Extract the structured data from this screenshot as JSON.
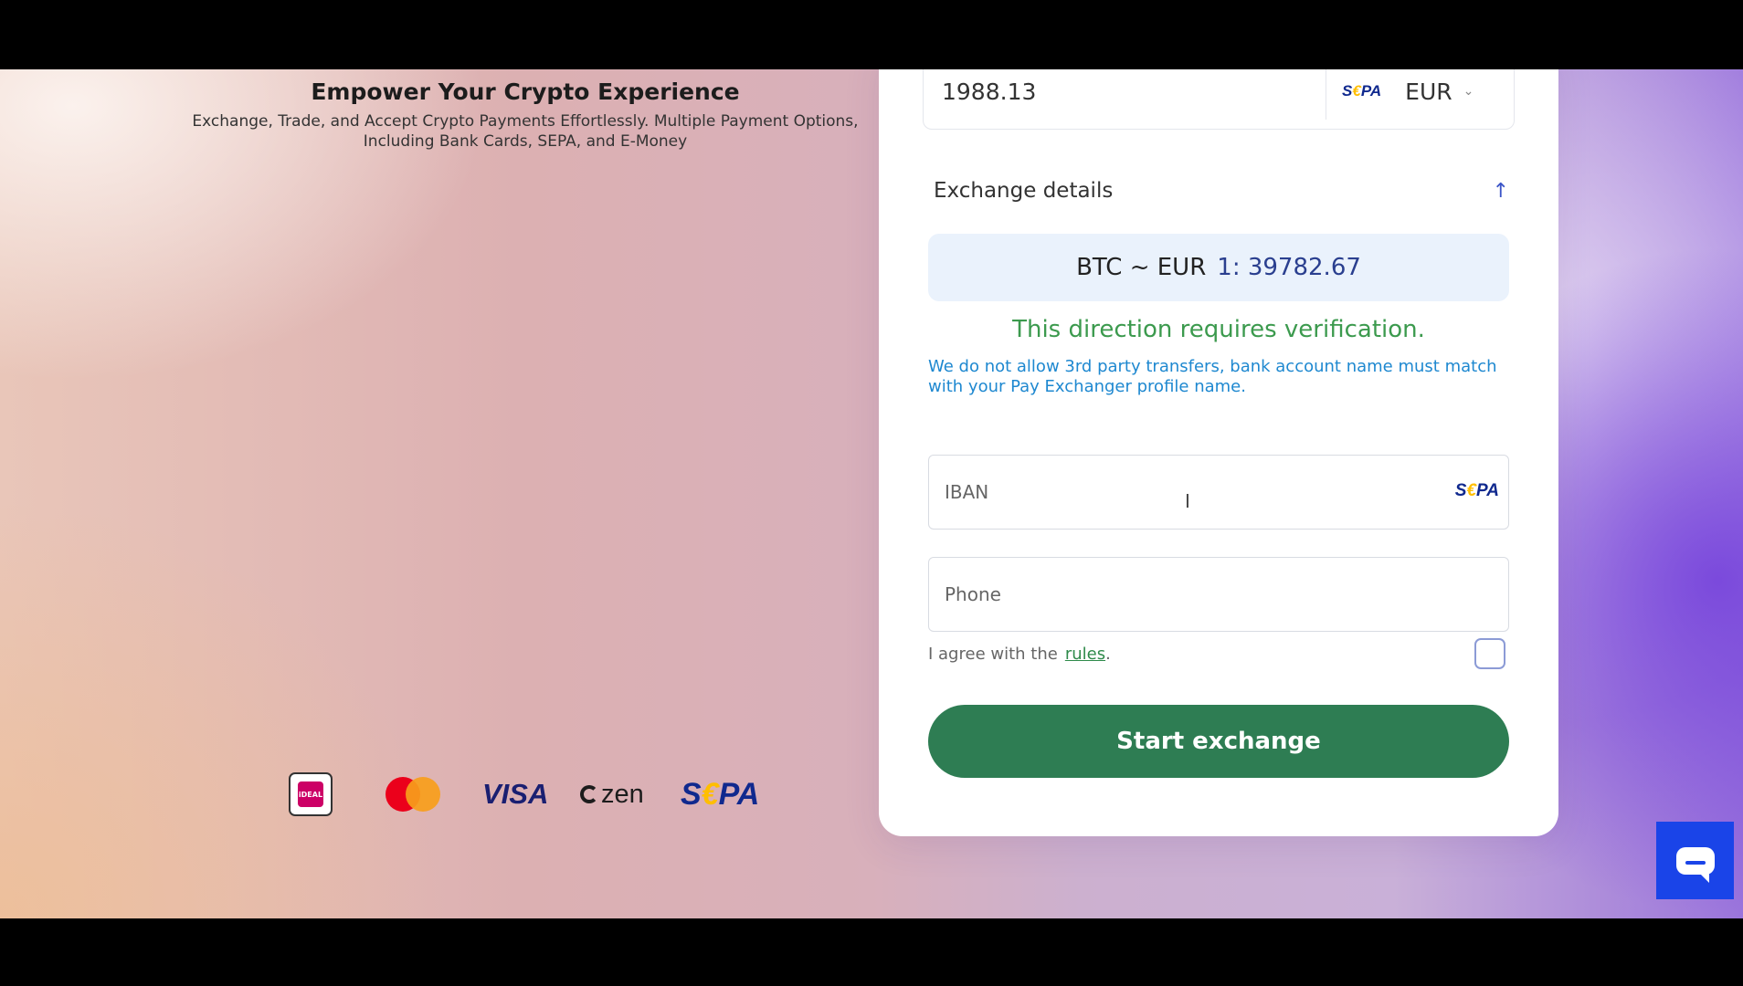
{
  "hero": {
    "title": "Empower Your Crypto Experience",
    "subtitle": "Exchange, Trade, and Accept Crypto Payments Effortlessly. Multiple Payment Options, Including Bank Cards, SEPA, and E-Money"
  },
  "payment_logos": {
    "ideal": "iDEAL",
    "visa": "VISA",
    "zen": "zen",
    "sepa_left": "S",
    "sepa_right": "PA"
  },
  "exchange": {
    "amount": "1988.13",
    "currency_logo_left": "S",
    "currency_logo_right": "PA",
    "currency": "EUR",
    "details_label": "Exchange details",
    "rate_pair": "BTC ~ EUR",
    "rate_value": "1: 39782.67",
    "verify_title": "This direction requires verification.",
    "verify_note": "We do not allow 3rd party transfers, bank account name must match with your Pay Exchanger profile name."
  },
  "form": {
    "iban_placeholder": "IBAN",
    "iban_logo_left": "S",
    "iban_logo_right": "PA",
    "phone_placeholder": "Phone",
    "agree_text": "I agree with the",
    "rules_link": "rules",
    "agree_period": ".",
    "agree_checked": false,
    "start_button": "Start exchange"
  },
  "colors": {
    "primary_button": "#2e7d53",
    "verify_green": "#3c9a4e",
    "note_blue": "#1e88d0",
    "rate_background": "#eaf2fc",
    "chat_widget": "#1a44e8"
  },
  "icons": {
    "collapse": "arrow-up-icon",
    "currency_dropdown": "chevron-down-icon",
    "chat": "chat-bubble-icon"
  }
}
